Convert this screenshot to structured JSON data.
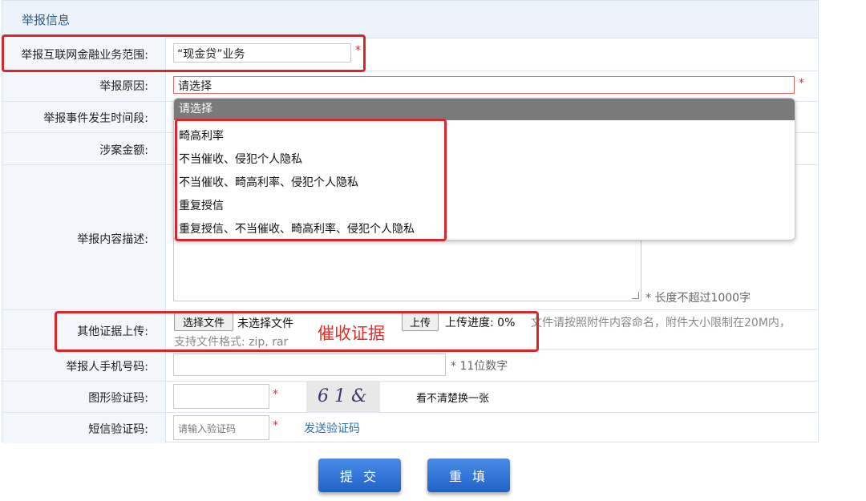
{
  "section": {
    "title": "举报信息"
  },
  "fields": {
    "scope": {
      "label": "举报互联网金融业务范围:",
      "value": "“现金贷”业务",
      "required": "*"
    },
    "reason": {
      "label": "举报原因:",
      "value": "请选择",
      "required": "*"
    },
    "period": {
      "label": "举报事件发生时间段:"
    },
    "amount": {
      "label": "涉案金额:"
    },
    "description": {
      "label": "举报内容描述:",
      "hint": "* 长度不超过1000字"
    },
    "evidence": {
      "label": "其他证据上传:",
      "choose_button": "选择文件",
      "no_file": "未选择文件",
      "upload_button": "上传",
      "progress_label": "上传进度: 0%",
      "note": "文件请按照附件内容命名，附件大小限制在20M内，",
      "formats": "支持文件格式: zip, rar",
      "annotation": "催收证据"
    },
    "phone": {
      "label": "举报人手机号码:",
      "hint": "* 11位数字"
    },
    "captcha": {
      "label": "图形验证码:",
      "required": "*",
      "image_text": "6 1 &",
      "refresh": "看不清楚换一张"
    },
    "sms": {
      "label": "短信验证码:",
      "placeholder": "请输入验证码",
      "required": "*",
      "send_link": "发送验证码"
    }
  },
  "dropdown": {
    "header": "请选择",
    "options": [
      "畸高利率",
      "不当催收、侵犯个人隐私",
      "不当催收、畸高利率、侵犯个人隐私",
      "重复授信",
      "重复授信、不当催收、畸高利率、侵犯个人隐私"
    ]
  },
  "actions": {
    "submit": "提 交",
    "reset": "重 填"
  },
  "colors": {
    "accent_red": "#d9262b",
    "button_blue": "#1f62c9",
    "label_bg": "#f3f7fc"
  }
}
